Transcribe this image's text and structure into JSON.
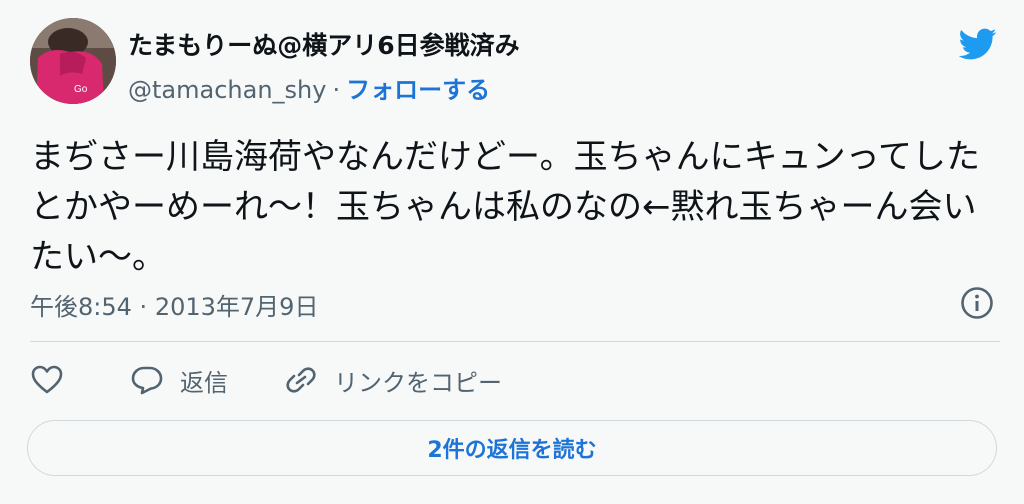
{
  "author": {
    "display_name": "たまもりーぬ@横アリ6日参戦済み",
    "handle": "@tamachan_shy",
    "separator": "·",
    "follow_label": "フォローする"
  },
  "tweet": {
    "text": "まぢさー川島海荷やなんだけどー。玉ちゃんにキュンってしたとかやーめーれ〜！玉ちゃんは私のなの←黙れ玉ちゃーん会いたい〜。",
    "time": "午後8:54",
    "meta_separator": "·",
    "date": "2013年7月9日"
  },
  "actions": {
    "reply_label": "返信",
    "copy_link_label": "リンクをコピー"
  },
  "replies_button_label": "2件の返信を読む",
  "icons": {
    "logo": "twitter-bird-icon",
    "info": "info-icon",
    "like": "heart-icon",
    "reply": "speech-bubble-icon",
    "link": "link-icon"
  },
  "colors": {
    "background": "#f7f9f9",
    "text": "#0f1419",
    "secondary": "#536471",
    "accent": "#1d74d6",
    "twitter_blue": "#1d9bf0",
    "border": "#cfd9de"
  }
}
